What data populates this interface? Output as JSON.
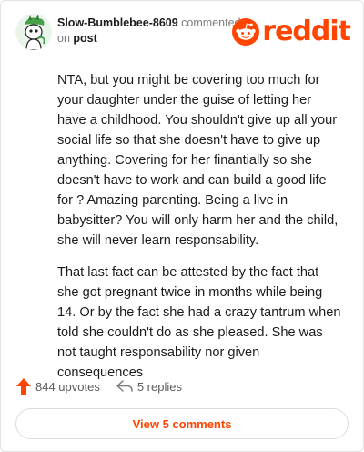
{
  "header": {
    "username": "Slow-Bumblebee-8609",
    "action_text": "commented",
    "on_text": "on",
    "post_link": "post",
    "brand": "reddit"
  },
  "comment": {
    "paragraphs": [
      "NTA, but you might be covering too much for your daughter under the guise of letting her have a childhood. You shouldn't give up all your social life so that she doesn't have to give up anything. Covering for her finantially so she doesn't have to work and can build a good life for ? Amazing parenting. Being a live in babysitter? You will only harm her and the child, she will never learn responsability.",
      "That last fact can be attested by the fact that she got pregnant twice in months while being 14. Or by the fact she had a crazy tantrum when told she couldn't do as she pleased. She was not taught responsability nor given consequences"
    ]
  },
  "actions": {
    "upvotes": "844 upvotes",
    "replies": "5 replies"
  },
  "view_comments_label": "View 5 comments",
  "colors": {
    "brand": "#ff4500",
    "text": "#1c1c1c",
    "muted": "#7c7c7c"
  },
  "icons": {
    "avatar": "snoo-avatar-icon",
    "logo": "reddit-snoo-icon",
    "upvote": "upvote-arrow-icon",
    "reply": "reply-arrow-icon"
  }
}
